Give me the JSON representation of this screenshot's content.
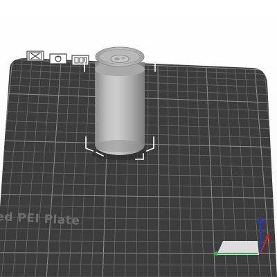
{
  "viewport": {
    "plate_label": "ed PEI Plate",
    "colors": {
      "plate": "#3c3c3c",
      "grid_minor": "#6b6b6b",
      "grid_major": "#8a8a8a",
      "model_light": "#c8c8c8",
      "model_dark": "#7d7d7d",
      "axis_x": "#2db34a",
      "axis_y": "#1b3bd1",
      "axis_z": "#d0202a",
      "background": "#ffffff"
    },
    "plate_toolbar": {
      "buttons": [
        {
          "icon": "close-plate-icon"
        },
        {
          "icon": "orient-plate-icon"
        },
        {
          "icon": "arrange-plate-icon"
        }
      ]
    },
    "model": {
      "icon": "can-model"
    },
    "axes": {
      "icon": "xyz-axis-gizmo"
    }
  }
}
